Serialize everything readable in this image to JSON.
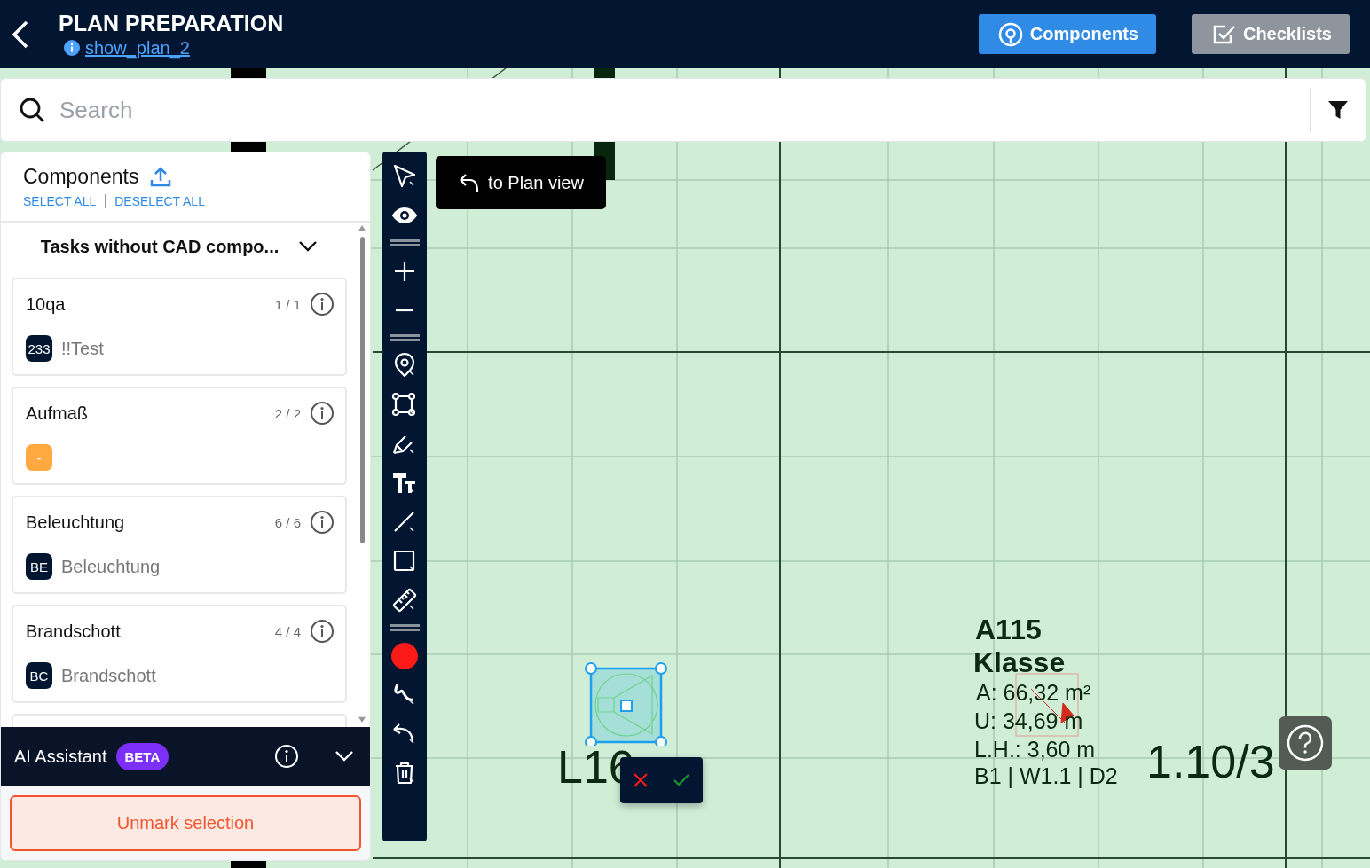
{
  "header": {
    "title": "PLAN PREPARATION",
    "plan_link": "show_plan_2",
    "buttons": [
      {
        "label": "Components",
        "selected": true
      },
      {
        "label": "Checklists",
        "selected": false
      }
    ]
  },
  "search": {
    "placeholder": "Search"
  },
  "components_panel": {
    "title": "Components",
    "select_all": "SELECT ALL",
    "deselect_all": "DESELECT ALL",
    "group": {
      "title": "Tasks without CAD compo...",
      "expanded": true
    },
    "cards": [
      {
        "name": "10qa",
        "count": "1 / 1",
        "tag": "233",
        "color": "#021631",
        "description": "!!Test"
      },
      {
        "name": "Aufmaß",
        "count": "2 / 2",
        "tag": "-",
        "color": "#ffa940"
      },
      {
        "name": "Beleuchtung",
        "count": "6 / 6",
        "tag": "BE",
        "color": "#021631",
        "description": "Beleuchtung"
      },
      {
        "name": "Brandschott",
        "count": "4 / 4",
        "tag": "BC",
        "color": "#021631",
        "description": "Brandschott"
      }
    ]
  },
  "ai_assistant": {
    "title": "AI Assistant",
    "badge": "BETA",
    "expanded": false
  },
  "unmark_button": "Unmark selection",
  "plan_view_button": "to Plan view",
  "plan": {
    "room": {
      "number": "A115",
      "name": "Klasse",
      "area": "A: 66,32 m²",
      "perimeter": "U: 34,69 m",
      "height": "L.H.: 3,60 m",
      "finishes": "B1 | W1.1 | D2"
    },
    "axis_label": "1.10/3",
    "symbol_label": "L16"
  }
}
